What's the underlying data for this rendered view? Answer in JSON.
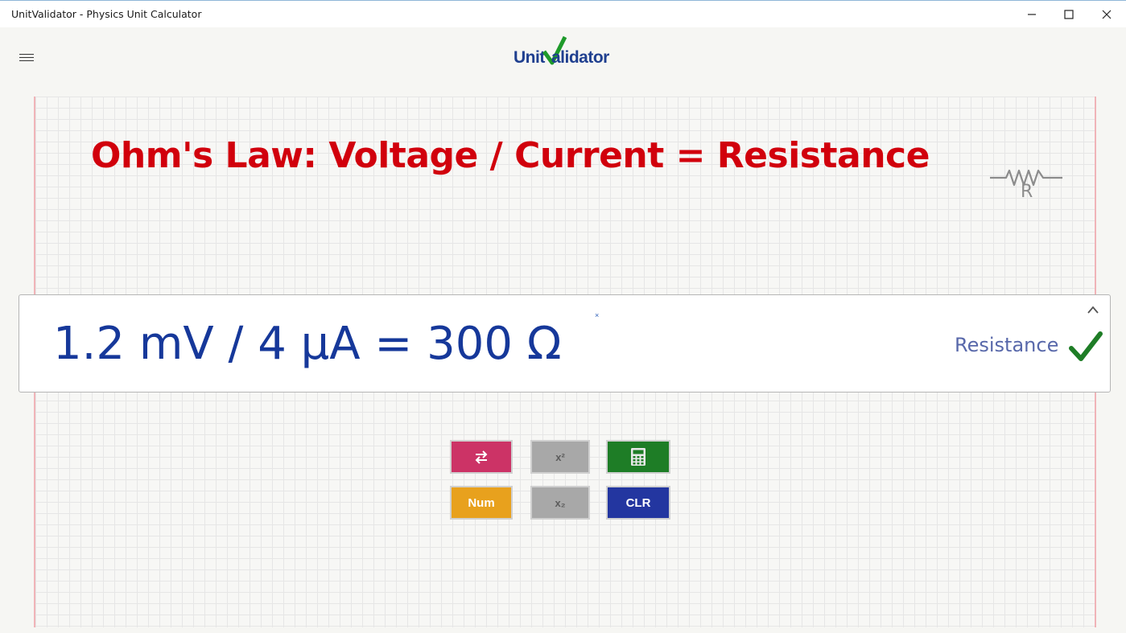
{
  "window": {
    "title": "UnitValidator - Physics Unit Calculator"
  },
  "header": {
    "logo_part1": "Unit",
    "logo_part2": "alidator"
  },
  "law": {
    "text": "Ohm's Law:  Voltage / Current = Resistance"
  },
  "symbol": {
    "icon": "resistor-icon",
    "label": "R"
  },
  "result": {
    "equation": "1.2 mV / 4 μA = 300 Ω",
    "unit_name": "Resistance",
    "status_icon": "checkmark-icon",
    "marker": "×"
  },
  "buttons": {
    "swap_icon": "swap-arrows-icon",
    "square_label": "x²",
    "calculator_icon": "calculator-icon",
    "num_label": "Num",
    "subscript_label": "x₂",
    "clear_label": "CLR"
  },
  "colors": {
    "law_red": "#d1000c",
    "equation_blue": "#16389a",
    "check_green": "#1e7d26",
    "swap_pink": "#cc3366",
    "num_orange": "#e8a11d",
    "clr_blue": "#2336a0",
    "calc_green": "#1e7d26",
    "neutral_gray": "#a8a8a8"
  }
}
